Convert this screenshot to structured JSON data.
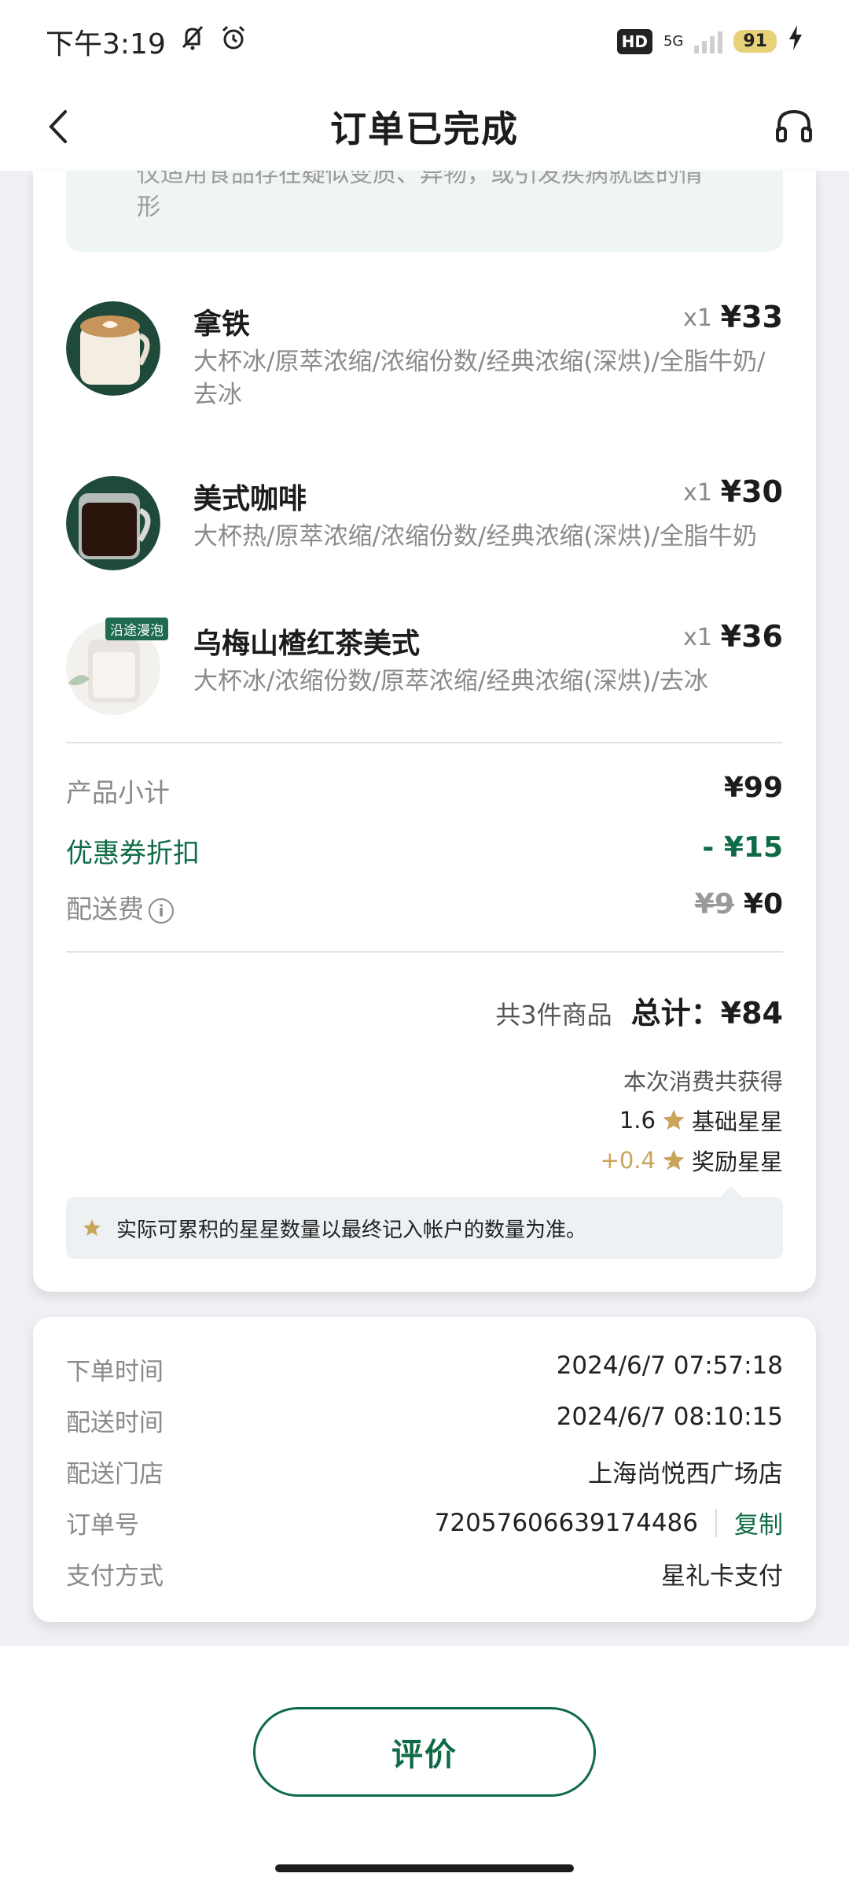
{
  "status_bar": {
    "time": "下午3:19",
    "hd": "HD",
    "network": "5G",
    "battery": "91"
  },
  "header": {
    "title": "订单已完成"
  },
  "notice": {
    "line1": "仅适用食品存在疑似变质、异物，或引发疾病就医的情",
    "line2": "形"
  },
  "items": [
    {
      "name": "拿铁",
      "qty": "x1",
      "price": "¥33",
      "spec": "大杯冰/原萃浓缩/浓缩份数/经典浓缩(深烘)/全脂牛奶/去冰"
    },
    {
      "name": "美式咖啡",
      "qty": "x1",
      "price": "¥30",
      "spec": "大杯热/原萃浓缩/浓缩份数/经典浓缩(深烘)/全脂牛奶"
    },
    {
      "name": "乌梅山楂红茶美式",
      "qty": "x1",
      "price": "¥36",
      "spec": "大杯冰/浓缩份数/原萃浓缩/经典浓缩(深烘)/去冰",
      "tag": "沿途漫泡"
    }
  ],
  "summary": {
    "subtotal_label": "产品小计",
    "subtotal_value": "¥99",
    "coupon_label": "优惠券折扣",
    "coupon_value": "- ¥15",
    "delivery_label": "配送费",
    "delivery_original": "¥9",
    "delivery_value": "¥0",
    "count_text": "共3件商品",
    "total_text": "总计：¥84"
  },
  "stars": {
    "heading": "本次消费共获得",
    "base_amount": "1.6",
    "base_label": "基础星星",
    "bonus_amount": "+0.4",
    "bonus_label": "奖励星星",
    "tip": "实际可累积的星星数量以最终记入帐户的数量为准。"
  },
  "order_info": {
    "rows": [
      {
        "key": "下单时间",
        "value": "2024/6/7 07:57:18"
      },
      {
        "key": "配送时间",
        "value": "2024/6/7 08:10:15"
      },
      {
        "key": "配送门店",
        "value": "上海尚悦西广场店"
      },
      {
        "key": "订单号",
        "value": "72057606639174486"
      },
      {
        "key": "支付方式",
        "value": "星礼卡支付"
      }
    ],
    "copy_label": "复制"
  },
  "actions": {
    "rate_label": "评价"
  },
  "colors": {
    "brand_green": "#0f6b46",
    "star_gold": "#c9a45b"
  }
}
